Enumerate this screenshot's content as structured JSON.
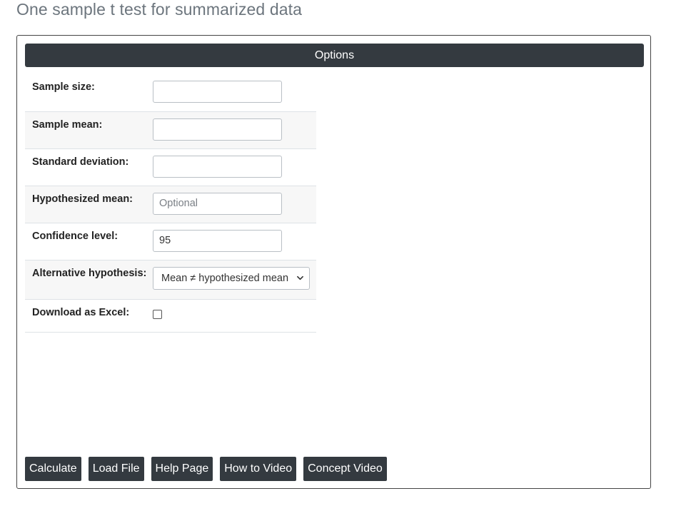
{
  "page": {
    "title": "One sample t test for summarized data"
  },
  "options": {
    "header": "Options",
    "fields": [
      {
        "label": "Sample size:",
        "value": "",
        "placeholder": ""
      },
      {
        "label": "Sample mean:",
        "value": "",
        "placeholder": ""
      },
      {
        "label": "Standard deviation:",
        "value": "",
        "placeholder": ""
      },
      {
        "label": "Hypothesized mean:",
        "value": "",
        "placeholder": "Optional"
      },
      {
        "label": "Confidence level:",
        "value": "95",
        "placeholder": ""
      }
    ],
    "alternative": {
      "label": "Alternative hypothesis:",
      "selected": "Mean ≠ hypothesized mean"
    },
    "download": {
      "label": "Download as Excel:",
      "checked": false
    }
  },
  "buttons": {
    "calculate": "Calculate",
    "load_file": "Load File",
    "help_page": "Help Page",
    "how_to_video": "How to Video",
    "concept_video": "Concept Video"
  },
  "colors": {
    "header_bg": "#343a40",
    "button_bg": "#343a40",
    "stripe_bg": "#f7f7f7",
    "title_text": "#6c757d"
  }
}
